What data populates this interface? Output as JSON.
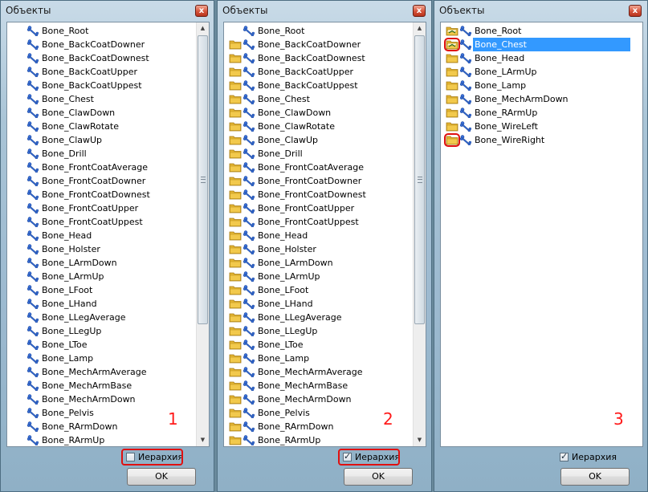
{
  "windows": [
    {
      "title": "Объекты",
      "close_label": "x",
      "hierarchy_label": "Иерархия",
      "hierarchy_checked": false,
      "ok_label": "OK",
      "number": "1",
      "scroll_position": 0.0,
      "items": [
        "Bone_Root",
        "Bone_BackCoatDowner",
        "Bone_BackCoatDownest",
        "Bone_BackCoatUpper",
        "Bone_BackCoatUppest",
        "Bone_Chest",
        "Bone_ClawDown",
        "Bone_ClawRotate",
        "Bone_ClawUp",
        "Bone_Drill",
        "Bone_FrontCoatAverage",
        "Bone_FrontCoatDowner",
        "Bone_FrontCoatDownest",
        "Bone_FrontCoatUpper",
        "Bone_FrontCoatUppest",
        "Bone_Head",
        "Bone_Holster",
        "Bone_LArmDown",
        "Bone_LArmUp",
        "Bone_LFoot",
        "Bone_LHand",
        "Bone_LLegAverage",
        "Bone_LLegUp",
        "Bone_LToe",
        "Bone_Lamp",
        "Bone_MechArmAverage",
        "Bone_MechArmBase",
        "Bone_MechArmDown",
        "Bone_Pelvis",
        "Bone_RArmDown",
        "Bone_RArmUp"
      ]
    },
    {
      "title": "Объекты",
      "close_label": "x",
      "hierarchy_label": "Иерархия",
      "hierarchy_checked": true,
      "ok_label": "OK",
      "number": "2",
      "scroll_position": 0.0,
      "items": [
        "Bone_Root",
        "Bone_BackCoatDowner",
        "Bone_BackCoatDownest",
        "Bone_BackCoatUpper",
        "Bone_BackCoatUppest",
        "Bone_Chest",
        "Bone_ClawDown",
        "Bone_ClawRotate",
        "Bone_ClawUp",
        "Bone_Drill",
        "Bone_FrontCoatAverage",
        "Bone_FrontCoatDowner",
        "Bone_FrontCoatDownest",
        "Bone_FrontCoatUpper",
        "Bone_FrontCoatUppest",
        "Bone_Head",
        "Bone_Holster",
        "Bone_LArmDown",
        "Bone_LArmUp",
        "Bone_LFoot",
        "Bone_LHand",
        "Bone_LLegAverage",
        "Bone_LLegUp",
        "Bone_LToe",
        "Bone_Lamp",
        "Bone_MechArmAverage",
        "Bone_MechArmBase",
        "Bone_MechArmDown",
        "Bone_Pelvis",
        "Bone_RArmDown",
        "Bone_RArmUp"
      ]
    },
    {
      "title": "Объекты",
      "close_label": "x",
      "hierarchy_label": "Иерархия",
      "hierarchy_checked": true,
      "ok_label": "OK",
      "number": "3",
      "selected_item": "Bone_Chest",
      "items": [
        "Bone_Root",
        "Bone_Chest",
        "Bone_Head",
        "Bone_LArmUp",
        "Bone_Lamp",
        "Bone_MechArmDown",
        "Bone_RArmUp",
        "Bone_WireLeft",
        "Bone_WireRight"
      ]
    }
  ],
  "colors": {
    "selection": "#3399ff",
    "highlight_outline": "#e01010",
    "annotation_number": "#ff1a1a",
    "bone_icon": "#3a6fd8",
    "folder_icon": "#f2c94c"
  },
  "icons": {
    "bone": "bone-icon",
    "folder": "folder-icon",
    "close": "close-icon",
    "checkbox": "checkbox-icon"
  }
}
